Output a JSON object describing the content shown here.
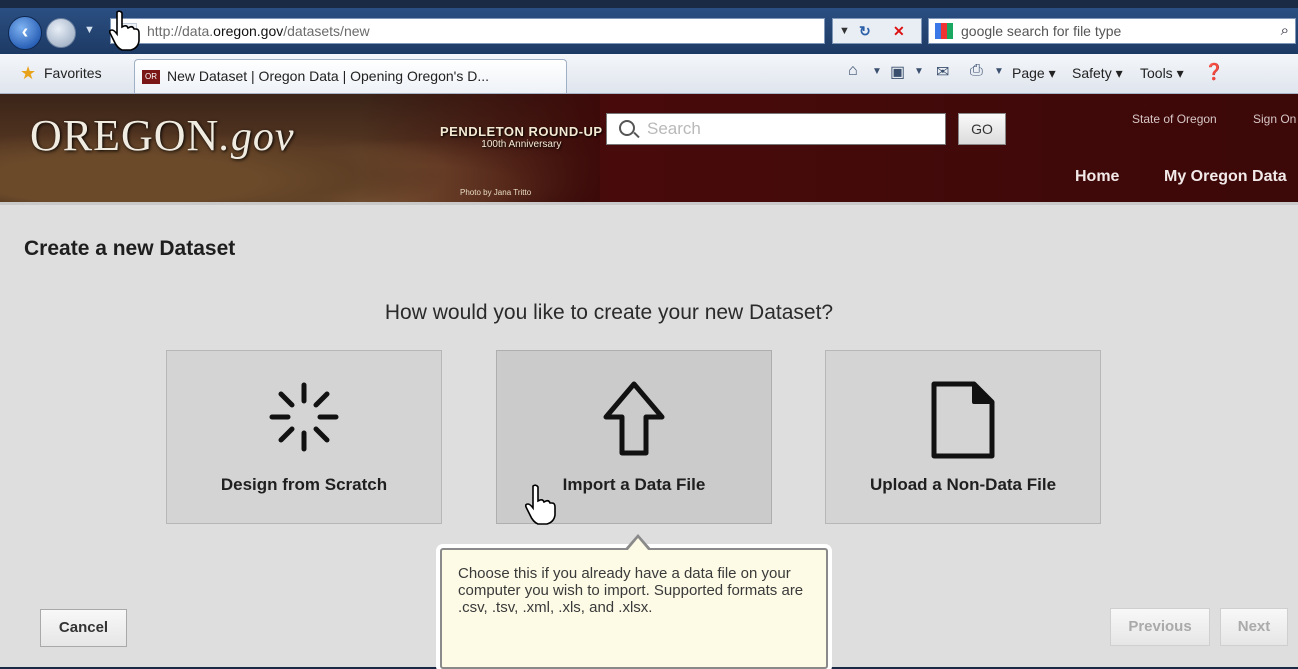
{
  "browser": {
    "url_prefix": "http://data.",
    "url_host": "oregon.gov",
    "url_suffix": "/datasets/new",
    "search_value": "google search for file type",
    "favorites_label": "Favorites",
    "tab_title": "New Dataset | Oregon Data | Opening Oregon's D...",
    "tab_icon_text": "OR",
    "commands": {
      "page": "Page ▾",
      "safety": "Safety ▾",
      "tools": "Tools ▾"
    }
  },
  "site": {
    "logo_main": "OREGON",
    "logo_gov": ".gov",
    "event_title": "PENDLETON ROUND-UP",
    "event_subtitle": "100th Anniversary",
    "photo_credit": "Photo by Jana Tritto",
    "search_placeholder": "Search",
    "go_label": "GO",
    "util_links": [
      "State of Oregon",
      "Sign On"
    ],
    "nav": [
      "Home",
      "My Oregon Data"
    ]
  },
  "page": {
    "title": "Create a new Dataset",
    "question": "How would you like to create your new Dataset?",
    "options": [
      {
        "label": "Design from Scratch",
        "icon": "spinner-icon"
      },
      {
        "label": "Import a Data File",
        "icon": "upload-arrow-icon"
      },
      {
        "label": "Upload a Non-Data File",
        "icon": "document-icon"
      }
    ],
    "tooltip": "Choose this if you already have a data file on your computer you wish to import. Supported formats are .csv, .tsv, .xml, .xls, and .xlsx.",
    "buttons": {
      "cancel": "Cancel",
      "previous": "Previous",
      "next": "Next"
    }
  },
  "colors": {
    "header_bg": "#4a0b0b",
    "page_bg": "#dedede",
    "tooltip_bg": "#fdfbe6"
  }
}
